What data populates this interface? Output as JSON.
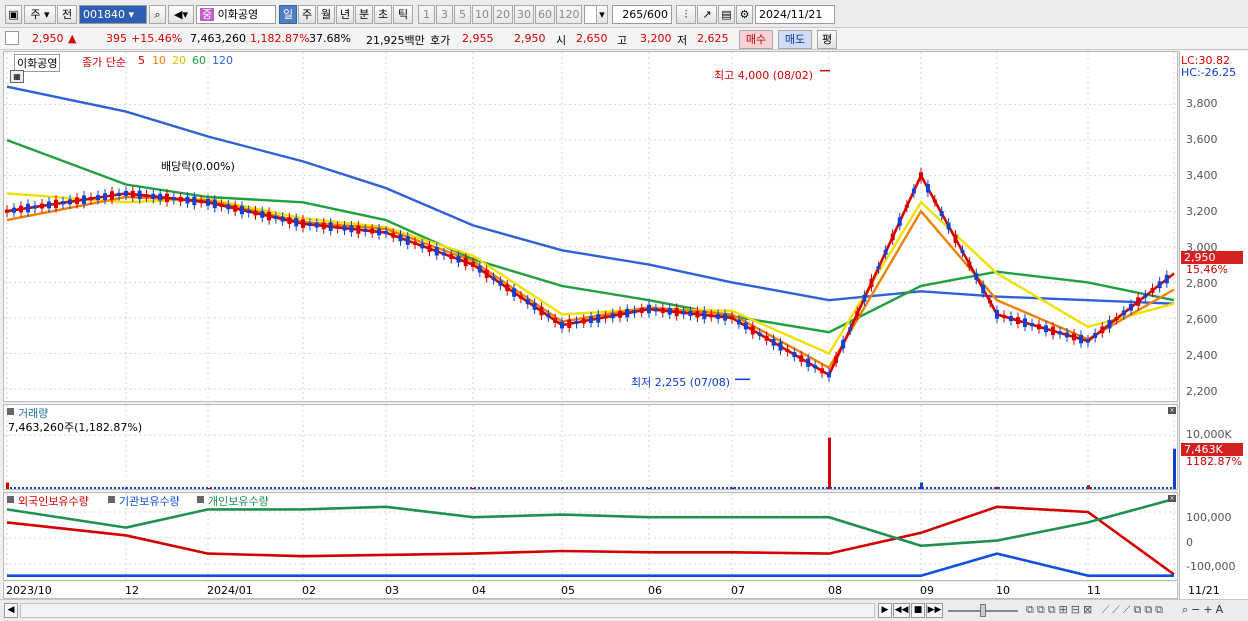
{
  "toolbar": {
    "period_options": [
      "주",
      "전"
    ],
    "code": "001840",
    "stock_name": "이화공영",
    "name_badge": "중",
    "periods": [
      "일",
      "주",
      "월",
      "년",
      "분",
      "초",
      "틱"
    ],
    "intervals": [
      "1",
      "3",
      "5",
      "10",
      "20",
      "30",
      "60",
      "120"
    ],
    "count": "265",
    "count_total": "/600",
    "date": "2024/11/21"
  },
  "info": {
    "price": "2,950",
    "arrow": "▲",
    "change": "395",
    "change_pct": "+15.46%",
    "volume": "7,463,260",
    "volume_pct": "1,182.87%",
    "turnover": "37.68%",
    "amount": "21,925백만",
    "quote_label": "호가",
    "quote1": "2,955",
    "quote2": "2,950",
    "open_label": "시",
    "open": "2,650",
    "high_label": "고",
    "high": "3,200",
    "low_label": "저",
    "low": "2,625",
    "buy": "매수",
    "sell": "매도",
    "eval": "평"
  },
  "price_panel": {
    "name": "이화공영",
    "ma_label": "종가 단순",
    "ma_periods": [
      "5",
      "10",
      "20",
      "60",
      "120"
    ],
    "ma_colors": [
      "#d40000",
      "#f08000",
      "#f0e000",
      "#20a040",
      "#3060d8"
    ],
    "lc": "LC:30.82",
    "hc": "HC:-26.25",
    "y_ticks": [
      "3,800",
      "3,600",
      "3,400",
      "3,200",
      "3,000",
      "2,800",
      "2,600",
      "2,400",
      "2,200"
    ],
    "last_price": "2,950",
    "last_pct": "15.46%",
    "high_annot": "최고 4,000 (08/02)",
    "low_annot": "최저 2,255 (07/08)",
    "div_annot": "배당락(0.00%)"
  },
  "volume_panel": {
    "title": "거래량",
    "value": "7,463,260주(1,182.87%)",
    "y_tick": "10,000K",
    "last": "7,463K",
    "last_pct": "1182.87%"
  },
  "holders_panel": {
    "series": [
      "외국인보유수량",
      "기관보유수량",
      "개인보유수량"
    ],
    "colors": [
      "#d40000",
      "#1050e0",
      "#209050"
    ],
    "y_ticks": [
      "100,000",
      "0",
      "-100,000"
    ]
  },
  "x_axis": [
    "2023/10",
    "12",
    "2024/01",
    "02",
    "03",
    "04",
    "05",
    "06",
    "07",
    "08",
    "09",
    "10",
    "11",
    "11/21"
  ],
  "bottom_controls": [
    "▶",
    "◀◀",
    "■",
    "▶▶"
  ],
  "chart_data": [
    {
      "type": "line",
      "title": "",
      "x": [
        "2023/10",
        "12",
        "2024/01",
        "02",
        "03",
        "04",
        "05",
        "06",
        "07",
        "08",
        "09",
        "10",
        "11",
        "11/21"
      ],
      "ylim": [
        2150,
        4050
      ],
      "series": [
        {
          "name": "5",
          "values": [
            3200,
            3300,
            3250,
            3130,
            3080,
            2900,
            2560,
            2650,
            2600,
            2280,
            3400,
            2620,
            2470,
            2850
          ]
        },
        {
          "name": "10",
          "values": [
            3150,
            3280,
            3260,
            3140,
            3100,
            2920,
            2580,
            2660,
            2620,
            2320,
            3200,
            2700,
            2480,
            2760
          ]
        },
        {
          "name": "20",
          "values": [
            3300,
            3250,
            3270,
            3160,
            3110,
            2950,
            2620,
            2650,
            2640,
            2400,
            3250,
            2850,
            2550,
            2680
          ]
        },
        {
          "name": "60",
          "values": [
            3600,
            3350,
            3280,
            3250,
            3150,
            2930,
            2780,
            2700,
            2610,
            2520,
            2780,
            2860,
            2800,
            2700
          ]
        },
        {
          "name": "120",
          "values": [
            3900,
            3760,
            3620,
            3480,
            3330,
            3120,
            2980,
            2900,
            2800,
            2700,
            2750,
            2720,
            2700,
            2680
          ]
        }
      ],
      "annotations": [
        "최고 4,000 (08/02)",
        "최저 2,255 (07/08)"
      ]
    },
    {
      "type": "bar",
      "title": "거래량",
      "x": [
        "2023/10",
        "12",
        "2024/01",
        "02",
        "03",
        "04",
        "05",
        "06",
        "07",
        "08",
        "09",
        "10",
        "11",
        "11/21"
      ],
      "values": [
        1200,
        300,
        200,
        150,
        150,
        200,
        300,
        200,
        300,
        9500,
        1200,
        400,
        700,
        7463
      ]
    },
    {
      "type": "line",
      "title": "",
      "x": [
        "2023/10",
        "12",
        "2024/01",
        "02",
        "03",
        "04",
        "05",
        "06",
        "07",
        "08",
        "09",
        "10",
        "11",
        "11/21"
      ],
      "ylim": [
        -150000,
        150000
      ],
      "series": [
        {
          "name": "외국인보유수량",
          "values": [
            60000,
            10000,
            -60000,
            -70000,
            -65000,
            -60000,
            -50000,
            -55000,
            -55000,
            -60000,
            20000,
            120000,
            100000,
            -140000
          ]
        },
        {
          "name": "기관보유수량",
          "values": [
            -145000,
            -145000,
            -145000,
            -145000,
            -145000,
            -145000,
            -145000,
            -145000,
            -145000,
            -145000,
            -145000,
            -60000,
            -145000,
            -145000
          ]
        },
        {
          "name": "개인보유수량",
          "values": [
            110000,
            40000,
            110000,
            110000,
            120000,
            80000,
            90000,
            80000,
            80000,
            80000,
            -30000,
            -10000,
            60000,
            150000
          ]
        }
      ]
    }
  ]
}
